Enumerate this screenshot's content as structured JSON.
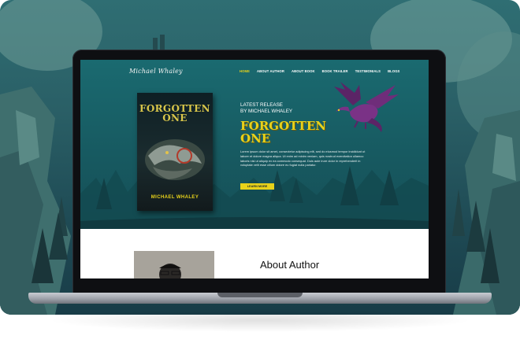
{
  "site": {
    "logo_text": "Michael Whaley",
    "nav": [
      {
        "label": "HOME",
        "active": true
      },
      {
        "label": "ABOUT AUTHOR",
        "active": false
      },
      {
        "label": "ABOUT BOOK",
        "active": false
      },
      {
        "label": "BOOK TRAILER",
        "active": false
      },
      {
        "label": "TESTIMONIALS",
        "active": false
      },
      {
        "label": "BLOGS",
        "active": false
      }
    ]
  },
  "hero": {
    "release_line1": "LATEST RELEASE",
    "release_line2": "BY MICHAEL WHALEY",
    "title_line1": "FORGOTTEN",
    "title_line2": "ONE",
    "description": "Lorem ipsum dolor sit amet, consectetur adipiscing elit, sed do eiusmod tempor incididunt ut labore et dolore magna aliqua. Ut enim ad minim veniam, quis nostrud exercitation ullamco laboris nisi ut aliquip ex ea commodo consequat. Duis aute irure dolor in reprehenderit in voluptate velit esse cillum dolore eu fugiat nulla pariatur.",
    "button_label": "LEARN MORE"
  },
  "book": {
    "title_line1": "FORGOTTEN",
    "title_line2": "ONE",
    "author": "MICHAEL WHALEY"
  },
  "about": {
    "title": "About Author"
  },
  "colors": {
    "accent_yellow": "#e8d21a",
    "hero_teal": "#1a6a70",
    "dragon_purple": "#6f2d7a"
  },
  "icons": {
    "dragon": "dragon-illustration",
    "cover_art": "dragon-cover-art"
  }
}
